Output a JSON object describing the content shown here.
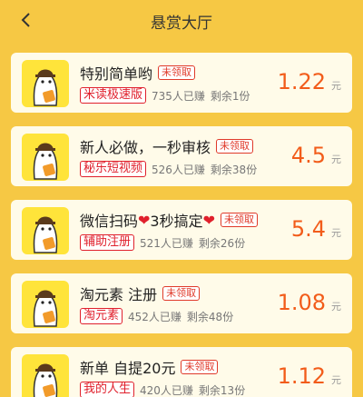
{
  "header": {
    "title": "悬赏大厅"
  },
  "tasks": [
    {
      "title": "特别简单哟",
      "status": "未领取",
      "app": "米读极速版",
      "earned": "735人已赚",
      "remaining": "剩余1份",
      "price": "1.22",
      "unit": "元"
    },
    {
      "title": "新人必做，一秒审核",
      "status": "未领取",
      "app": "秘乐短视频",
      "earned": "526人已赚",
      "remaining": "剩余38份",
      "price": "4.5",
      "unit": "元"
    },
    {
      "title_a": "微信扫码",
      "title_b": "3秒搞定",
      "status": "未领取",
      "app": "辅助注册",
      "earned": "521人已赚",
      "remaining": "剩余26份",
      "price": "5.4",
      "unit": "元"
    },
    {
      "title": "淘元素 注册",
      "status": "未领取",
      "app": "淘元素",
      "earned": "452人已赚",
      "remaining": "剩余48份",
      "price": "1.08",
      "unit": "元"
    },
    {
      "title": "新单 自提20元",
      "status": "未领取",
      "app": "我的人生",
      "earned": "420人已赚",
      "remaining": "剩余13份",
      "price": "1.12",
      "unit": "元"
    }
  ],
  "colors": {
    "background": "#f6c844",
    "card": "#fffbe9",
    "avatar": "#ffe43a",
    "price": "#f25c1a",
    "tag": "#e0202c"
  }
}
